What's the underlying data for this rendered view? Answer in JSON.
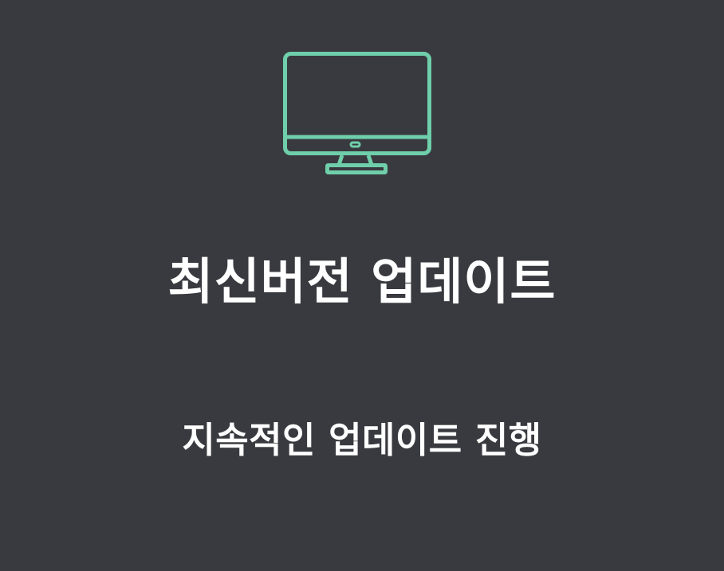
{
  "feature": {
    "icon": "monitor-icon",
    "title": "최신버전 업데이트",
    "subtitle": "지속적인 업데이트 진행"
  },
  "colors": {
    "background": "#393a3f",
    "icon_accent": "#6fcfab",
    "text": "#ffffff"
  }
}
